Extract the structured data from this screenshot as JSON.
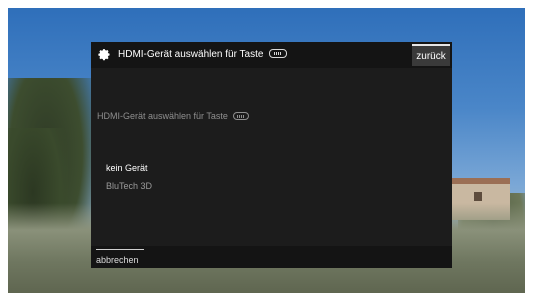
{
  "dialog": {
    "title": "HDMI-Gerät auswählen für Taste",
    "back_label": "zurück",
    "subtitle": "HDMI-Gerät auswählen für Taste",
    "options": [
      {
        "label": "kein Gerät",
        "selected": true
      },
      {
        "label": "BluTech 3D",
        "selected": false
      }
    ],
    "cancel_label": "abbrechen",
    "icons": {
      "header": "gear-icon",
      "remote_button": "remote-button-icon"
    }
  }
}
